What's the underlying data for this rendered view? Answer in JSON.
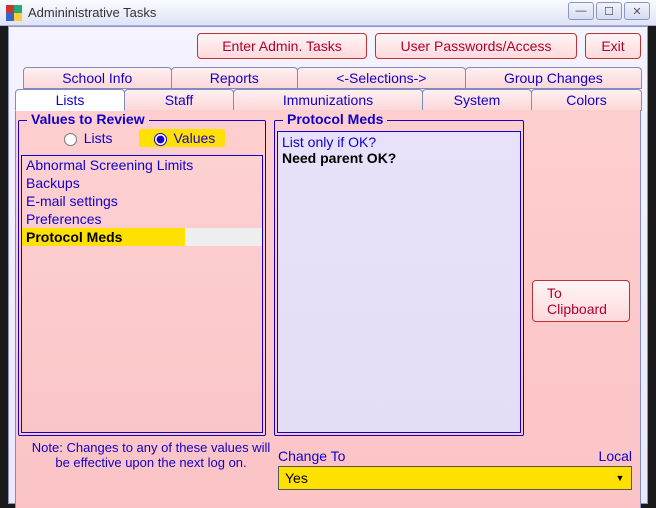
{
  "window": {
    "title": "Admininistrative Tasks",
    "min_glyph": "—",
    "max_glyph": "☐",
    "close_glyph": "✕"
  },
  "topbuttons": {
    "enter_admin": "Enter Admin. Tasks",
    "user_passwords": "User Passwords/Access",
    "exit": "Exit"
  },
  "tabs_row1": {
    "school_info": "School Info",
    "reports": "Reports",
    "selections": "<-Selections->",
    "group_changes": "Group Changes"
  },
  "tabs_row2": {
    "lists": "Lists",
    "staff": "Staff",
    "immunizations": "Immunizations",
    "system": "System",
    "colors": "Colors"
  },
  "values_group": {
    "legend": "Values to Review",
    "radio_lists": "Lists",
    "radio_values": "Values",
    "items": {
      "abnormal": "Abnormal Screening Limits",
      "backups": "Backups",
      "email": "E-mail settings",
      "preferences": "Preferences",
      "protocol_meds": "Protocol Meds"
    }
  },
  "detail_group": {
    "legend": "Protocol Meds",
    "line1": "List only if OK?",
    "line2": "Need parent OK?"
  },
  "clipboard_btn": "To Clipboard",
  "note": "Note: Changes to any of these values will be effective upon the next log on.",
  "change": {
    "label": "Change To",
    "right_label": "Local",
    "value": "Yes"
  }
}
